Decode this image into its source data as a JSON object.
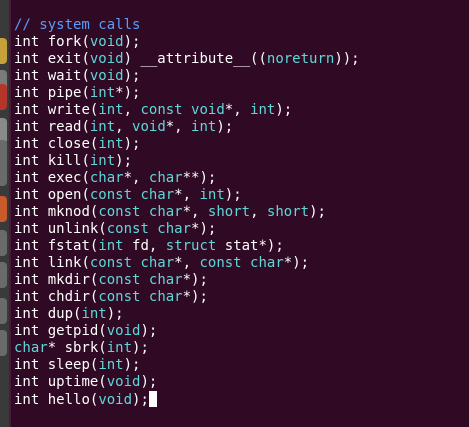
{
  "colors": {
    "background": "#300a24",
    "text": "#ffffff",
    "comment": "#5c9cf5",
    "type_highlight": "#5fd7d7"
  },
  "launcher": {
    "icons": [
      {
        "name": "launcher-icon-1",
        "color": "#c7a23a"
      },
      {
        "name": "launcher-icon-2",
        "color": "#7a7a7a"
      },
      {
        "name": "launcher-icon-3",
        "color": "#b5352a"
      },
      {
        "name": "launcher-icon-4",
        "color": "#8a8a8a"
      },
      {
        "name": "launcher-icon-5",
        "color": "#6a6a6a"
      },
      {
        "name": "launcher-icon-6",
        "color": "#6a6a6a"
      },
      {
        "name": "launcher-icon-7",
        "color": "#c95a2a"
      },
      {
        "name": "launcher-icon-8",
        "color": "#6a6a6a"
      },
      {
        "name": "launcher-icon-9",
        "color": "#6a6a6a"
      },
      {
        "name": "launcher-icon-10",
        "color": "#6a6a6a"
      },
      {
        "name": "launcher-icon-11",
        "color": "#6a6a6a"
      }
    ]
  },
  "editor": {
    "lines": [
      [
        {
          "t": "// system calls",
          "c": "comment"
        }
      ],
      [
        {
          "t": "int",
          "c": "plain"
        },
        {
          "t": " fork(",
          "c": "plain"
        },
        {
          "t": "void",
          "c": "type"
        },
        {
          "t": ");",
          "c": "plain"
        }
      ],
      [
        {
          "t": "int",
          "c": "plain"
        },
        {
          "t": " exit(",
          "c": "plain"
        },
        {
          "t": "void",
          "c": "type"
        },
        {
          "t": ") __attribute__((",
          "c": "plain"
        },
        {
          "t": "noreturn",
          "c": "type"
        },
        {
          "t": "));",
          "c": "plain"
        }
      ],
      [
        {
          "t": "int",
          "c": "plain"
        },
        {
          "t": " wait(",
          "c": "plain"
        },
        {
          "t": "void",
          "c": "type"
        },
        {
          "t": ");",
          "c": "plain"
        }
      ],
      [
        {
          "t": "int",
          "c": "plain"
        },
        {
          "t": " pipe(",
          "c": "plain"
        },
        {
          "t": "int",
          "c": "type"
        },
        {
          "t": "*);",
          "c": "plain"
        }
      ],
      [
        {
          "t": "int",
          "c": "plain"
        },
        {
          "t": " write(",
          "c": "plain"
        },
        {
          "t": "int",
          "c": "type"
        },
        {
          "t": ", ",
          "c": "plain"
        },
        {
          "t": "const void",
          "c": "type"
        },
        {
          "t": "*, ",
          "c": "plain"
        },
        {
          "t": "int",
          "c": "type"
        },
        {
          "t": ");",
          "c": "plain"
        }
      ],
      [
        {
          "t": "int",
          "c": "plain"
        },
        {
          "t": " read(",
          "c": "plain"
        },
        {
          "t": "int",
          "c": "type"
        },
        {
          "t": ", ",
          "c": "plain"
        },
        {
          "t": "void",
          "c": "type"
        },
        {
          "t": "*, ",
          "c": "plain"
        },
        {
          "t": "int",
          "c": "type"
        },
        {
          "t": ");",
          "c": "plain"
        }
      ],
      [
        {
          "t": "int",
          "c": "plain"
        },
        {
          "t": " close(",
          "c": "plain"
        },
        {
          "t": "int",
          "c": "type"
        },
        {
          "t": ");",
          "c": "plain"
        }
      ],
      [
        {
          "t": "int",
          "c": "plain"
        },
        {
          "t": " kill(",
          "c": "plain"
        },
        {
          "t": "int",
          "c": "type"
        },
        {
          "t": ");",
          "c": "plain"
        }
      ],
      [
        {
          "t": "int",
          "c": "plain"
        },
        {
          "t": " exec(",
          "c": "plain"
        },
        {
          "t": "char",
          "c": "type"
        },
        {
          "t": "*, ",
          "c": "plain"
        },
        {
          "t": "char",
          "c": "type"
        },
        {
          "t": "**);",
          "c": "plain"
        }
      ],
      [
        {
          "t": "int",
          "c": "plain"
        },
        {
          "t": " open(",
          "c": "plain"
        },
        {
          "t": "const char",
          "c": "type"
        },
        {
          "t": "*, ",
          "c": "plain"
        },
        {
          "t": "int",
          "c": "type"
        },
        {
          "t": ");",
          "c": "plain"
        }
      ],
      [
        {
          "t": "int",
          "c": "plain"
        },
        {
          "t": " mknod(",
          "c": "plain"
        },
        {
          "t": "const char",
          "c": "type"
        },
        {
          "t": "*, ",
          "c": "plain"
        },
        {
          "t": "short",
          "c": "type"
        },
        {
          "t": ", ",
          "c": "plain"
        },
        {
          "t": "short",
          "c": "type"
        },
        {
          "t": ");",
          "c": "plain"
        }
      ],
      [
        {
          "t": "int",
          "c": "plain"
        },
        {
          "t": " unlink(",
          "c": "plain"
        },
        {
          "t": "const char",
          "c": "type"
        },
        {
          "t": "*);",
          "c": "plain"
        }
      ],
      [
        {
          "t": "int",
          "c": "plain"
        },
        {
          "t": " fstat(",
          "c": "plain"
        },
        {
          "t": "int",
          "c": "type"
        },
        {
          "t": " fd, ",
          "c": "plain"
        },
        {
          "t": "struct",
          "c": "type"
        },
        {
          "t": " stat*);",
          "c": "plain"
        }
      ],
      [
        {
          "t": "int",
          "c": "plain"
        },
        {
          "t": " link(",
          "c": "plain"
        },
        {
          "t": "const char",
          "c": "type"
        },
        {
          "t": "*, ",
          "c": "plain"
        },
        {
          "t": "const char",
          "c": "type"
        },
        {
          "t": "*);",
          "c": "plain"
        }
      ],
      [
        {
          "t": "int",
          "c": "plain"
        },
        {
          "t": " mkdir(",
          "c": "plain"
        },
        {
          "t": "const char",
          "c": "type"
        },
        {
          "t": "*);",
          "c": "plain"
        }
      ],
      [
        {
          "t": "int",
          "c": "plain"
        },
        {
          "t": " chdir(",
          "c": "plain"
        },
        {
          "t": "const char",
          "c": "type"
        },
        {
          "t": "*);",
          "c": "plain"
        }
      ],
      [
        {
          "t": "int",
          "c": "plain"
        },
        {
          "t": " dup(",
          "c": "plain"
        },
        {
          "t": "int",
          "c": "type"
        },
        {
          "t": ");",
          "c": "plain"
        }
      ],
      [
        {
          "t": "int",
          "c": "plain"
        },
        {
          "t": " getpid(",
          "c": "plain"
        },
        {
          "t": "void",
          "c": "type"
        },
        {
          "t": ");",
          "c": "plain"
        }
      ],
      [
        {
          "t": "char",
          "c": "type"
        },
        {
          "t": "* sbrk(",
          "c": "plain"
        },
        {
          "t": "int",
          "c": "type"
        },
        {
          "t": ");",
          "c": "plain"
        }
      ],
      [
        {
          "t": "int",
          "c": "plain"
        },
        {
          "t": " sleep(",
          "c": "plain"
        },
        {
          "t": "int",
          "c": "type"
        },
        {
          "t": ");",
          "c": "plain"
        }
      ],
      [
        {
          "t": "int",
          "c": "plain"
        },
        {
          "t": " uptime(",
          "c": "plain"
        },
        {
          "t": "void",
          "c": "type"
        },
        {
          "t": ");",
          "c": "plain"
        }
      ],
      [
        {
          "t": "int",
          "c": "plain"
        },
        {
          "t": " hello(",
          "c": "plain"
        },
        {
          "t": "void",
          "c": "type"
        },
        {
          "t": ");",
          "c": "plain"
        }
      ]
    ],
    "cursor_line": 22
  }
}
